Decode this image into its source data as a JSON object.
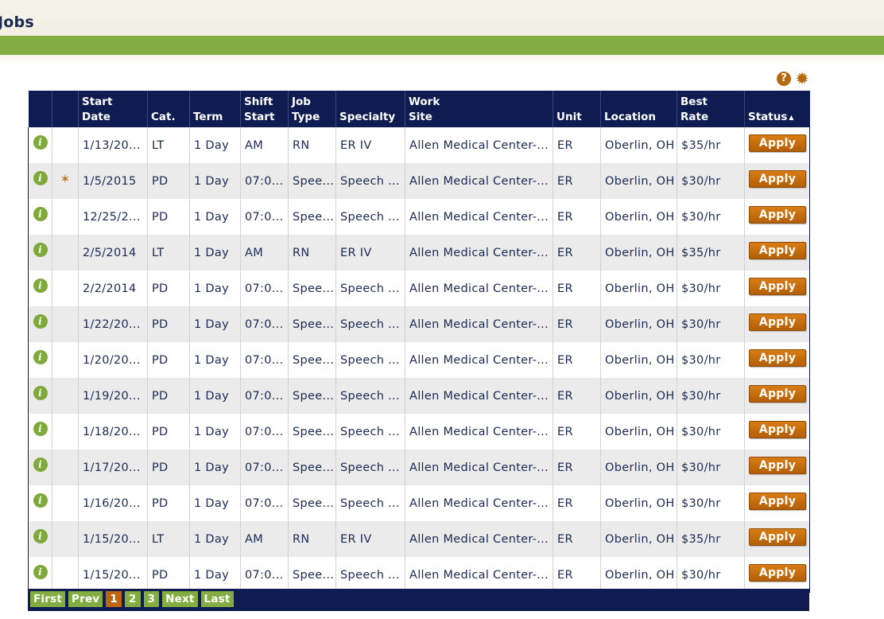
{
  "page": {
    "title": "Jobs"
  },
  "toolbar": {
    "help_glyph": "?",
    "settings_glyph": "✹"
  },
  "colors": {
    "nav_bar": "#84ad41",
    "header_bg": "#0f1c52",
    "apply_btn": "#c0650f",
    "info_icon": "#7fa93a"
  },
  "table": {
    "headers": [
      {
        "line1": "",
        "line2": ""
      },
      {
        "line1": "",
        "line2": ""
      },
      {
        "line1": "Start",
        "line2": "Date"
      },
      {
        "line1": "",
        "line2": "Cat."
      },
      {
        "line1": "",
        "line2": "Term"
      },
      {
        "line1": "Shift",
        "line2": "Start"
      },
      {
        "line1": "Job",
        "line2": "Type"
      },
      {
        "line1": "",
        "line2": "Specialty"
      },
      {
        "line1": "Work",
        "line2": "Site"
      },
      {
        "line1": "",
        "line2": "Unit"
      },
      {
        "line1": "",
        "line2": "Location"
      },
      {
        "line1": "Best",
        "line2": "Rate"
      },
      {
        "line1": "",
        "line2": "Status"
      }
    ],
    "sort_indicator": "▲",
    "info_glyph": "i",
    "star_glyph": "✶",
    "rows": [
      {
        "star": false,
        "start_date": "1/13/20...",
        "cat": "LT",
        "term": "1 Day",
        "shift_start": "AM",
        "job_type": "RN",
        "specialty": "ER IV",
        "work_site": "Allen Medical Center-...",
        "unit": "ER",
        "location": "Oberlin, OH",
        "best_rate": "$35/hr",
        "action": "Apply"
      },
      {
        "star": true,
        "start_date": "1/5/2015",
        "cat": "PD",
        "term": "1 Day",
        "shift_start": "07:0...",
        "job_type": "Spee...",
        "specialty": "Speech ...",
        "work_site": "Allen Medical Center-...",
        "unit": "ER",
        "location": "Oberlin, OH",
        "best_rate": "$30/hr",
        "action": "Apply"
      },
      {
        "star": false,
        "start_date": "12/25/2...",
        "cat": "PD",
        "term": "1 Day",
        "shift_start": "07:0...",
        "job_type": "Spee...",
        "specialty": "Speech ...",
        "work_site": "Allen Medical Center-...",
        "unit": "ER",
        "location": "Oberlin, OH",
        "best_rate": "$30/hr",
        "action": "Apply"
      },
      {
        "star": false,
        "start_date": "2/5/2014",
        "cat": "LT",
        "term": "1 Day",
        "shift_start": "AM",
        "job_type": "RN",
        "specialty": "ER IV",
        "work_site": "Allen Medical Center-...",
        "unit": "ER",
        "location": "Oberlin, OH",
        "best_rate": "$35/hr",
        "action": "Apply"
      },
      {
        "star": false,
        "start_date": "2/2/2014",
        "cat": "PD",
        "term": "1 Day",
        "shift_start": "07:0...",
        "job_type": "Spee...",
        "specialty": "Speech ...",
        "work_site": "Allen Medical Center-...",
        "unit": "ER",
        "location": "Oberlin, OH",
        "best_rate": "$30/hr",
        "action": "Apply"
      },
      {
        "star": false,
        "start_date": "1/22/20...",
        "cat": "PD",
        "term": "1 Day",
        "shift_start": "07:0...",
        "job_type": "Spee...",
        "specialty": "Speech ...",
        "work_site": "Allen Medical Center-...",
        "unit": "ER",
        "location": "Oberlin, OH",
        "best_rate": "$30/hr",
        "action": "Apply"
      },
      {
        "star": false,
        "start_date": "1/20/20...",
        "cat": "PD",
        "term": "1 Day",
        "shift_start": "07:0...",
        "job_type": "Spee...",
        "specialty": "Speech ...",
        "work_site": "Allen Medical Center-...",
        "unit": "ER",
        "location": "Oberlin, OH",
        "best_rate": "$30/hr",
        "action": "Apply"
      },
      {
        "star": false,
        "start_date": "1/19/20...",
        "cat": "PD",
        "term": "1 Day",
        "shift_start": "07:0...",
        "job_type": "Spee...",
        "specialty": "Speech ...",
        "work_site": "Allen Medical Center-...",
        "unit": "ER",
        "location": "Oberlin, OH",
        "best_rate": "$30/hr",
        "action": "Apply"
      },
      {
        "star": false,
        "start_date": "1/18/20...",
        "cat": "PD",
        "term": "1 Day",
        "shift_start": "07:0...",
        "job_type": "Spee...",
        "specialty": "Speech ...",
        "work_site": "Allen Medical Center-...",
        "unit": "ER",
        "location": "Oberlin, OH",
        "best_rate": "$30/hr",
        "action": "Apply"
      },
      {
        "star": false,
        "start_date": "1/17/20...",
        "cat": "PD",
        "term": "1 Day",
        "shift_start": "07:0...",
        "job_type": "Spee...",
        "specialty": "Speech ...",
        "work_site": "Allen Medical Center-...",
        "unit": "ER",
        "location": "Oberlin, OH",
        "best_rate": "$30/hr",
        "action": "Apply"
      },
      {
        "star": false,
        "start_date": "1/16/20...",
        "cat": "PD",
        "term": "1 Day",
        "shift_start": "07:0...",
        "job_type": "Spee...",
        "specialty": "Speech ...",
        "work_site": "Allen Medical Center-...",
        "unit": "ER",
        "location": "Oberlin, OH",
        "best_rate": "$30/hr",
        "action": "Apply"
      },
      {
        "star": false,
        "start_date": "1/15/20...",
        "cat": "LT",
        "term": "1 Day",
        "shift_start": "AM",
        "job_type": "RN",
        "specialty": "ER IV",
        "work_site": "Allen Medical Center-...",
        "unit": "ER",
        "location": "Oberlin, OH",
        "best_rate": "$35/hr",
        "action": "Apply"
      },
      {
        "star": false,
        "start_date": "1/15/20...",
        "cat": "PD",
        "term": "1 Day",
        "shift_start": "07:0...",
        "job_type": "Spee...",
        "specialty": "Speech ...",
        "work_site": "Allen Medical Center-...",
        "unit": "ER",
        "location": "Oberlin, OH",
        "best_rate": "$30/hr",
        "action": "Apply"
      }
    ]
  },
  "pager": {
    "first": "First",
    "prev": "Prev",
    "pages": [
      "1",
      "2",
      "3"
    ],
    "current_page": "1",
    "next": "Next",
    "last": "Last"
  }
}
